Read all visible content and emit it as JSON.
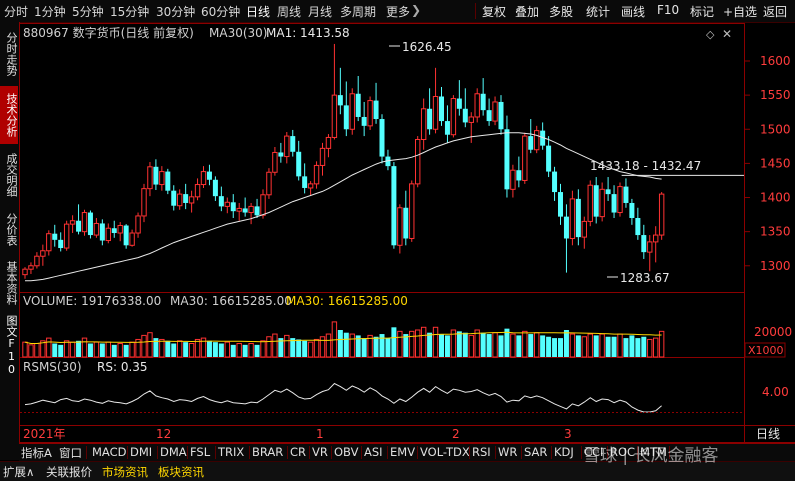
{
  "toolbar": {
    "periods": [
      "分时",
      "1分钟",
      "5分钟",
      "15分钟",
      "30分钟",
      "60分钟",
      "日线",
      "周线",
      "月线",
      "多周期",
      "更多"
    ],
    "selected_period": "日线",
    "nav_glyph": "❯",
    "actions": [
      "复权",
      "叠加",
      "多股",
      "统计",
      "画线",
      "F10",
      "标记"
    ],
    "add_fav": "+自选",
    "back": "返回"
  },
  "sidebar": {
    "tabs": [
      "分时走势",
      "技术分析",
      "成交明细",
      "分价表",
      "基本资料",
      "图文F10"
    ],
    "active": "技术分析"
  },
  "main_chart": {
    "header": "880967 数字货币(日线 前复权)",
    "ma_label": "MA30(30)",
    "ma_value": "MA1: 1413.58",
    "high_label": "1626.45",
    "low_label": "1283.67",
    "right_labels": "1433.18 - 1432.47",
    "y_ticks": [
      "1600",
      "1550",
      "1500",
      "1450",
      "1400",
      "1350",
      "1300"
    ],
    "colors": {
      "up": "#ff3232",
      "down": "#54ffff",
      "ma": "#e8e8e8",
      "grid": "#8b0000"
    }
  },
  "volume_panel": {
    "label": "VOLUME: 19176338.00",
    "ma_label": "MA30: 16615285.00",
    "ma_label2": "MA30: 16615285.00",
    "y_tick": "20000",
    "unit": "X1000"
  },
  "rsms_panel": {
    "label": "RSMS(30)",
    "rs": "RS: 0.35",
    "y_tick": "4.00"
  },
  "x_axis": {
    "labels": [
      "2021年",
      "12",
      "1",
      "2",
      "3"
    ],
    "period_label": "日线"
  },
  "indicators": {
    "prefix": [
      "指标A",
      "窗口"
    ],
    "items": [
      "MACD",
      "DMI",
      "DMA",
      "FSL",
      "TRIX",
      "BRAR",
      "CR",
      "VR",
      "OBV",
      "ASI",
      "EMV",
      "VOL-TDX",
      "RSI",
      "WR",
      "SAR",
      "KDJ",
      "CCI",
      "ROC",
      "MTM"
    ]
  },
  "bottom": {
    "items": [
      "扩展∧",
      "关联报价",
      "市场资讯",
      "板块资讯"
    ],
    "watermark": "雪球 | 长风金融客"
  },
  "candles": [
    [
      1287,
      1298,
      1281,
      1295
    ],
    [
      1295,
      1305,
      1288,
      1300
    ],
    [
      1300,
      1320,
      1296,
      1314
    ],
    [
      1314,
      1331,
      1300,
      1322
    ],
    [
      1322,
      1352,
      1315,
      1347
    ],
    [
      1347,
      1360,
      1328,
      1338
    ],
    [
      1338,
      1349,
      1321,
      1326
    ],
    [
      1326,
      1366,
      1322,
      1361
    ],
    [
      1361,
      1374,
      1348,
      1366
    ],
    [
      1366,
      1390,
      1346,
      1350
    ],
    [
      1350,
      1382,
      1344,
      1378
    ],
    [
      1378,
      1381,
      1340,
      1345
    ],
    [
      1345,
      1370,
      1341,
      1362
    ],
    [
      1362,
      1368,
      1330,
      1337
    ],
    [
      1337,
      1362,
      1333,
      1355
    ],
    [
      1355,
      1366,
      1341,
      1348
    ],
    [
      1348,
      1364,
      1336,
      1359
    ],
    [
      1359,
      1361,
      1325,
      1330
    ],
    [
      1330,
      1353,
      1328,
      1348
    ],
    [
      1348,
      1378,
      1341,
      1373
    ],
    [
      1373,
      1420,
      1364,
      1413
    ],
    [
      1413,
      1452,
      1402,
      1445
    ],
    [
      1445,
      1456,
      1411,
      1419
    ],
    [
      1419,
      1446,
      1410,
      1438
    ],
    [
      1438,
      1442,
      1405,
      1410
    ],
    [
      1410,
      1418,
      1381,
      1388
    ],
    [
      1388,
      1412,
      1382,
      1405
    ],
    [
      1405,
      1420,
      1383,
      1392
    ],
    [
      1392,
      1410,
      1378,
      1401
    ],
    [
      1401,
      1428,
      1396,
      1419
    ],
    [
      1419,
      1446,
      1414,
      1438
    ],
    [
      1438,
      1448,
      1418,
      1426
    ],
    [
      1426,
      1431,
      1395,
      1402
    ],
    [
      1402,
      1416,
      1380,
      1387
    ],
    [
      1387,
      1400,
      1377,
      1393
    ],
    [
      1393,
      1405,
      1370,
      1380
    ],
    [
      1380,
      1392,
      1366,
      1384
    ],
    [
      1384,
      1400,
      1372,
      1378
    ],
    [
      1378,
      1392,
      1361,
      1387
    ],
    [
      1387,
      1398,
      1370,
      1374
    ],
    [
      1374,
      1412,
      1369,
      1404
    ],
    [
      1404,
      1443,
      1398,
      1437
    ],
    [
      1437,
      1474,
      1432,
      1466
    ],
    [
      1466,
      1480,
      1451,
      1460
    ],
    [
      1460,
      1496,
      1450,
      1490
    ],
    [
      1490,
      1499,
      1460,
      1467
    ],
    [
      1467,
      1483,
      1425,
      1431
    ],
    [
      1431,
      1450,
      1406,
      1414
    ],
    [
      1414,
      1424,
      1403,
      1420
    ],
    [
      1420,
      1453,
      1413,
      1447
    ],
    [
      1447,
      1480,
      1432,
      1472
    ],
    [
      1472,
      1493,
      1459,
      1488
    ],
    [
      1488,
      1625,
      1485,
      1550
    ],
    [
      1550,
      1590,
      1522,
      1535
    ],
    [
      1535,
      1570,
      1490,
      1500
    ],
    [
      1500,
      1560,
      1492,
      1552
    ],
    [
      1552,
      1578,
      1512,
      1518
    ],
    [
      1518,
      1540,
      1490,
      1505
    ],
    [
      1505,
      1548,
      1499,
      1542
    ],
    [
      1542,
      1568,
      1508,
      1515
    ],
    [
      1515,
      1522,
      1450,
      1460
    ],
    [
      1460,
      1470,
      1440,
      1446
    ],
    [
      1446,
      1452,
      1325,
      1330
    ],
    [
      1330,
      1390,
      1318,
      1385
    ],
    [
      1385,
      1410,
      1330,
      1340
    ],
    [
      1340,
      1425,
      1335,
      1420
    ],
    [
      1420,
      1490,
      1415,
      1485
    ],
    [
      1485,
      1545,
      1470,
      1530
    ],
    [
      1530,
      1560,
      1492,
      1500
    ],
    [
      1500,
      1590,
      1494,
      1548
    ],
    [
      1548,
      1562,
      1505,
      1512
    ],
    [
      1512,
      1535,
      1480,
      1492
    ],
    [
      1492,
      1550,
      1488,
      1545
    ],
    [
      1545,
      1572,
      1520,
      1530
    ],
    [
      1530,
      1560,
      1503,
      1510
    ],
    [
      1510,
      1525,
      1480,
      1518
    ],
    [
      1518,
      1560,
      1510,
      1552
    ],
    [
      1552,
      1575,
      1520,
      1528
    ],
    [
      1528,
      1545,
      1505,
      1512
    ],
    [
      1512,
      1548,
      1506,
      1540
    ],
    [
      1540,
      1550,
      1492,
      1500
    ],
    [
      1500,
      1520,
      1400,
      1412
    ],
    [
      1412,
      1448,
      1400,
      1440
    ],
    [
      1440,
      1460,
      1415,
      1425
    ],
    [
      1425,
      1495,
      1420,
      1490
    ],
    [
      1490,
      1515,
      1465,
      1470
    ],
    [
      1470,
      1505,
      1465,
      1498
    ],
    [
      1498,
      1510,
      1470,
      1476
    ],
    [
      1476,
      1490,
      1430,
      1438
    ],
    [
      1438,
      1445,
      1395,
      1408
    ],
    [
      1408,
      1420,
      1360,
      1372
    ],
    [
      1372,
      1390,
      1290,
      1340
    ],
    [
      1340,
      1410,
      1330,
      1398
    ],
    [
      1398,
      1412,
      1330,
      1342
    ],
    [
      1342,
      1372,
      1325,
      1365
    ],
    [
      1365,
      1425,
      1358,
      1418
    ],
    [
      1418,
      1430,
      1362,
      1372
    ],
    [
      1372,
      1422,
      1365,
      1412
    ],
    [
      1412,
      1430,
      1395,
      1405
    ],
    [
      1405,
      1418,
      1370,
      1378
    ],
    [
      1378,
      1422,
      1372,
      1416
    ],
    [
      1416,
      1428,
      1385,
      1392
    ],
    [
      1392,
      1398,
      1360,
      1370
    ],
    [
      1370,
      1385,
      1338,
      1345
    ],
    [
      1345,
      1360,
      1310,
      1320
    ],
    [
      1320,
      1345,
      1292,
      1335
    ],
    [
      1335,
      1358,
      1305,
      1345
    ],
    [
      1345,
      1408,
      1338,
      1405
    ]
  ],
  "ma_line": [
    1278,
    1278,
    1279,
    1280,
    1282,
    1284,
    1286,
    1288,
    1290,
    1292,
    1294,
    1296,
    1298,
    1300,
    1302,
    1304,
    1306,
    1308,
    1310,
    1312,
    1315,
    1318,
    1322,
    1326,
    1330,
    1334,
    1337,
    1340,
    1343,
    1346,
    1349,
    1352,
    1355,
    1358,
    1361,
    1363,
    1365,
    1367,
    1369,
    1372,
    1375,
    1378,
    1382,
    1386,
    1390,
    1394,
    1397,
    1400,
    1403,
    1406,
    1409,
    1413,
    1418,
    1423,
    1428,
    1433,
    1437,
    1441,
    1445,
    1449,
    1452,
    1454,
    1455,
    1456,
    1457,
    1459,
    1462,
    1466,
    1470,
    1474,
    1477,
    1480,
    1483,
    1485,
    1487,
    1489,
    1490,
    1491,
    1492,
    1493,
    1494,
    1495,
    1495,
    1495,
    1494,
    1493,
    1491,
    1488,
    1485,
    1481,
    1477,
    1472,
    1468,
    1464,
    1460,
    1456,
    1452,
    1448,
    1444,
    1441,
    1438,
    1436,
    1434,
    1432,
    1431,
    1430,
    1428,
    1427
  ],
  "volumes": [
    11,
    9,
    10,
    12,
    14,
    10,
    9,
    12,
    11,
    12,
    14,
    10,
    11,
    10,
    11,
    9,
    10,
    9,
    11,
    13,
    16,
    18,
    14,
    13,
    12,
    10,
    12,
    11,
    10,
    13,
    14,
    12,
    11,
    10,
    11,
    9,
    10,
    9,
    10,
    9,
    12,
    15,
    17,
    14,
    16,
    14,
    13,
    12,
    11,
    13,
    15,
    17,
    26,
    20,
    18,
    17,
    16,
    14,
    16,
    15,
    17,
    14,
    22,
    19,
    17,
    19,
    20,
    22,
    18,
    22,
    17,
    16,
    20,
    19,
    18,
    16,
    20,
    18,
    17,
    18,
    16,
    21,
    17,
    16,
    19,
    17,
    18,
    16,
    15,
    14,
    14,
    20,
    17,
    16,
    15,
    17,
    16,
    17,
    15,
    15,
    17,
    14,
    16,
    14,
    15,
    13,
    14,
    19
  ],
  "rsms": [
    2.6,
    2.7,
    3.0,
    3.3,
    3.1,
    2.9,
    3.4,
    3.6,
    3.2,
    3.1,
    3.5,
    3.3,
    3.0,
    2.8,
    3.2,
    3.0,
    2.9,
    2.7,
    3.1,
    3.6,
    4.3,
    4.8,
    4.0,
    3.7,
    3.5,
    3.1,
    3.4,
    3.3,
    3.1,
    3.6,
    3.9,
    3.4,
    3.1,
    2.9,
    3.2,
    2.9,
    2.8,
    2.7,
    3.0,
    2.9,
    3.5,
    4.2,
    4.9,
    4.6,
    5.1,
    4.5,
    3.8,
    3.5,
    3.6,
    4.2,
    4.7,
    5.0,
    6.0,
    5.5,
    4.9,
    5.6,
    5.2,
    4.6,
    5.3,
    4.8,
    4.0,
    3.5,
    2.8,
    3.5,
    3.1,
    3.8,
    4.6,
    5.2,
    4.6,
    5.5,
    4.9,
    4.4,
    5.1,
    4.9,
    4.6,
    4.7,
    5.0,
    4.5,
    4.1,
    4.4,
    3.9,
    3.0,
    3.3,
    3.2,
    4.0,
    3.7,
    4.0,
    3.7,
    3.2,
    2.7,
    2.3,
    1.9,
    2.7,
    2.4,
    3.0,
    3.7,
    3.1,
    3.5,
    3.4,
    2.9,
    3.3,
    3.0,
    2.2,
    1.7,
    1.4,
    1.4,
    1.6,
    2.4
  ]
}
